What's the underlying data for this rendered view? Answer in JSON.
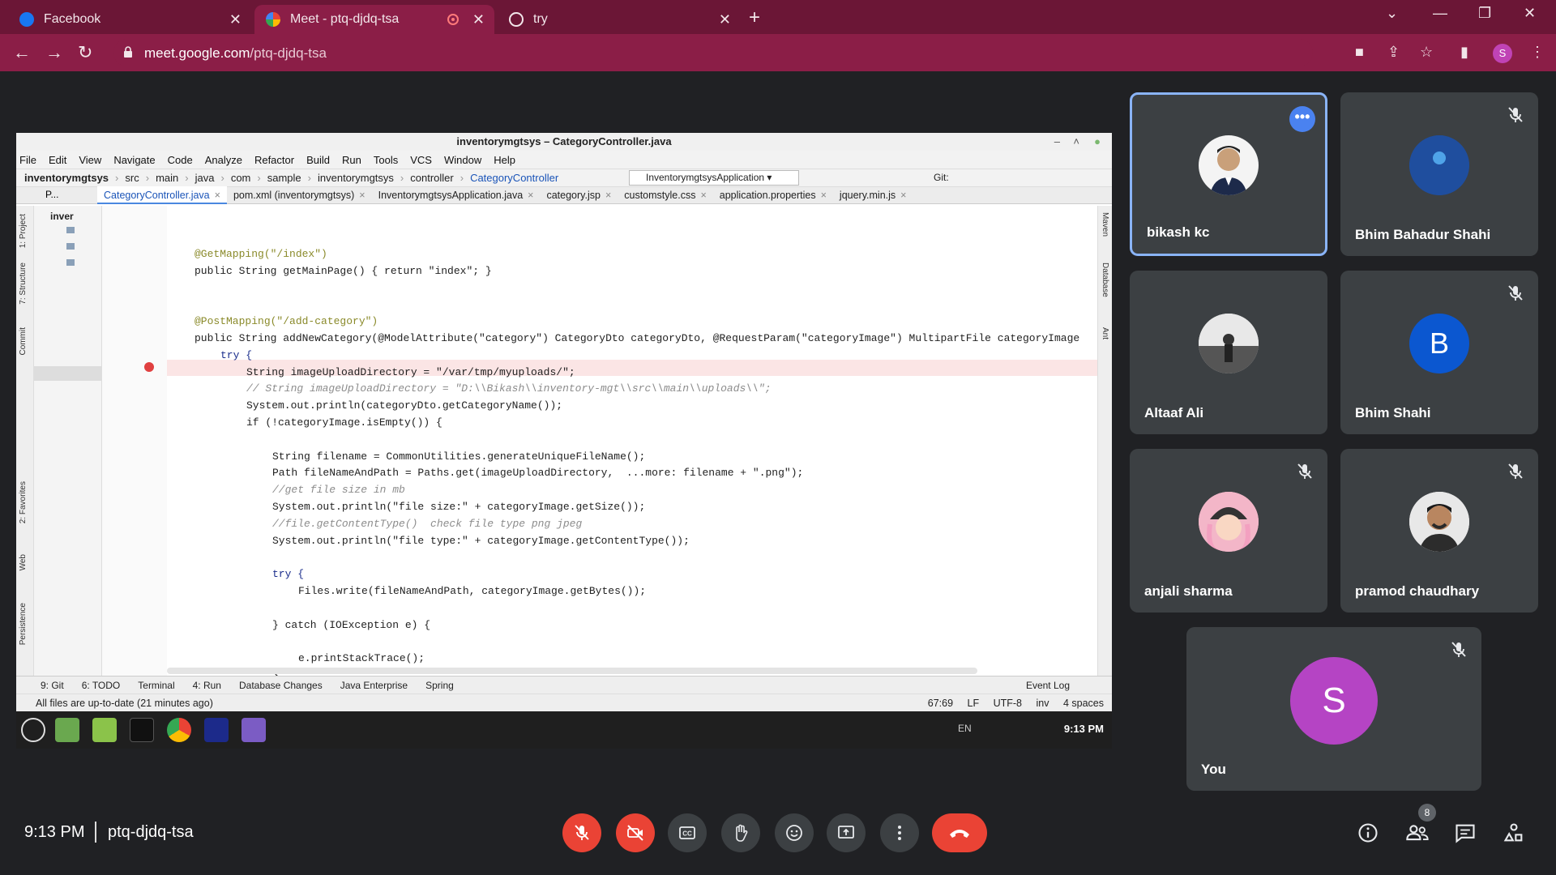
{
  "browser": {
    "tabs": [
      {
        "title": "Facebook",
        "favicon": "facebook-icon",
        "color": "#1877f2"
      },
      {
        "title": "Meet - ptq-djdq-tsa",
        "favicon": "meet-icon",
        "color": "#00ac47"
      },
      {
        "title": "try",
        "favicon": "globe-icon",
        "color": "#ffffff"
      }
    ],
    "url_host": "meet.google.com",
    "url_path": "/ptq-djdq-tsa",
    "profile_initial": "S"
  },
  "ide": {
    "window_title": "inventorymgtsys – CategoryController.java",
    "menu": [
      "File",
      "Edit",
      "View",
      "Navigate",
      "Code",
      "Analyze",
      "Refactor",
      "Build",
      "Run",
      "Tools",
      "VCS",
      "Window",
      "Help"
    ],
    "breadcrumbs": [
      "inventorymgtsys",
      "src",
      "main",
      "java",
      "com",
      "sample",
      "inventorymgtsys",
      "controller",
      "CategoryController"
    ],
    "run_config": "InventorymgtsysApplication",
    "git_label": "Git:",
    "project_label": "P...",
    "project_root": "inver",
    "file_tabs": [
      "CategoryController.java",
      "pom.xml (inventorymgtsys)",
      "InventorymgtsysApplication.java",
      "category.jsp",
      "customstyle.css",
      "application.properties",
      "jquery.min.js"
    ],
    "left_tool_labels": [
      "1: Project",
      "7: Structure",
      "Commit",
      "2: Favorites",
      "Web",
      "Persistence"
    ],
    "right_tool_labels": [
      "Maven",
      "Database",
      "Ant"
    ],
    "code_lines": [
      {
        "text": "@GetMapping(\"/index\")",
        "indent": 0,
        "cls": "ann"
      },
      {
        "text": "public String getMainPage() { return \"index\"; }",
        "indent": 0,
        "cls": ""
      },
      {
        "text": "",
        "indent": 0,
        "cls": ""
      },
      {
        "text": "",
        "indent": 0,
        "cls": ""
      },
      {
        "text": "@PostMapping(\"/add-category\")",
        "indent": 0,
        "cls": "ann"
      },
      {
        "text": "public String addNewCategory(@ModelAttribute(\"category\") CategoryDto categoryDto, @RequestParam(\"categoryImage\") MultipartFile categoryImage",
        "indent": 0,
        "cls": ""
      },
      {
        "text": "try {",
        "indent": 1,
        "cls": "kw"
      },
      {
        "text": "String imageUploadDirectory = \"/var/tmp/myuploads/\";",
        "indent": 2,
        "cls": ""
      },
      {
        "text": "// String imageUploadDirectory = \"D:\\\\Bikash\\\\inventory-mgt\\\\src\\\\main\\\\uploads\\\\\";",
        "indent": 2,
        "cls": "cmt"
      },
      {
        "text": "System.out.println(categoryDto.getCategoryName());",
        "indent": 2,
        "cls": ""
      },
      {
        "text": "if (!categoryImage.isEmpty()) {",
        "indent": 2,
        "cls": ""
      },
      {
        "text": "",
        "indent": 0,
        "cls": ""
      },
      {
        "text": "String filename = CommonUtilities.generateUniqueFileName();",
        "indent": 3,
        "cls": ""
      },
      {
        "text": "Path fileNameAndPath = Paths.get(imageUploadDirectory,  ...more: filename + \".png\");",
        "indent": 3,
        "cls": ""
      },
      {
        "text": "//get file size in mb",
        "indent": 3,
        "cls": "cmt"
      },
      {
        "text": "System.out.println(\"file size:\" + categoryImage.getSize());",
        "indent": 3,
        "cls": ""
      },
      {
        "text": "//file.getContentType()  check file type png jpeg",
        "indent": 3,
        "cls": "cmt"
      },
      {
        "text": "System.out.println(\"file type:\" + categoryImage.getContentType());",
        "indent": 3,
        "cls": ""
      },
      {
        "text": "",
        "indent": 0,
        "cls": ""
      },
      {
        "text": "try {",
        "indent": 3,
        "cls": "kw"
      },
      {
        "text": "Files.write(fileNameAndPath, categoryImage.getBytes());",
        "indent": 4,
        "cls": ""
      },
      {
        "text": "",
        "indent": 0,
        "cls": ""
      },
      {
        "text": "} catch (IOException e) {",
        "indent": 3,
        "cls": ""
      },
      {
        "text": "",
        "indent": 0,
        "cls": ""
      },
      {
        "text": "e.printStackTrace();",
        "indent": 4,
        "cls": ""
      },
      {
        "text": "}",
        "indent": 3,
        "cls": ""
      }
    ],
    "tool_windows": [
      "9: Git",
      "6: TODO",
      "Terminal",
      "4: Run",
      "Database Changes",
      "Java Enterprise",
      "Spring"
    ],
    "event_log": "Event Log",
    "status_left": "All files are up-to-date (21 minutes ago)",
    "status_right": [
      "67:69",
      "LF",
      "UTF-8",
      "inv",
      "4 spaces"
    ],
    "taskbar_lang": "EN",
    "taskbar_time": "9:13 PM"
  },
  "participants": [
    {
      "name": "bikash kc",
      "initial": "",
      "avatar_color": "#ffffff",
      "muted": false,
      "speaking": true
    },
    {
      "name": "Bhim Bahadur Shahi",
      "initial": "",
      "avatar_color": "#1f4e9e",
      "muted": true,
      "speaking": false
    },
    {
      "name": "Altaaf Ali",
      "initial": "",
      "avatar_color": "#d9d9d9",
      "muted": false,
      "speaking": false
    },
    {
      "name": "Bhim Shahi",
      "initial": "B",
      "avatar_color": "#0b57d0",
      "muted": true,
      "speaking": false
    },
    {
      "name": "anjali sharma",
      "initial": "",
      "avatar_color": "#f3b6c8",
      "muted": true,
      "speaking": false
    },
    {
      "name": "pramod chaudhary",
      "initial": "",
      "avatar_color": "#e8e8e8",
      "muted": true,
      "speaking": false
    },
    {
      "name": "You",
      "initial": "S",
      "avatar_color": "#b544c4",
      "muted": true,
      "speaking": false
    }
  ],
  "meeting": {
    "time": "9:13 PM",
    "code": "ptq-djdq-tsa",
    "participant_count": "8"
  },
  "colors": {
    "browser_frame": "#6b1636",
    "browser_toolbar": "#8b1e47",
    "meet_bg": "#202124",
    "tile_bg": "#3c4043",
    "danger": "#ea4335",
    "accent": "#8ab4f8"
  }
}
